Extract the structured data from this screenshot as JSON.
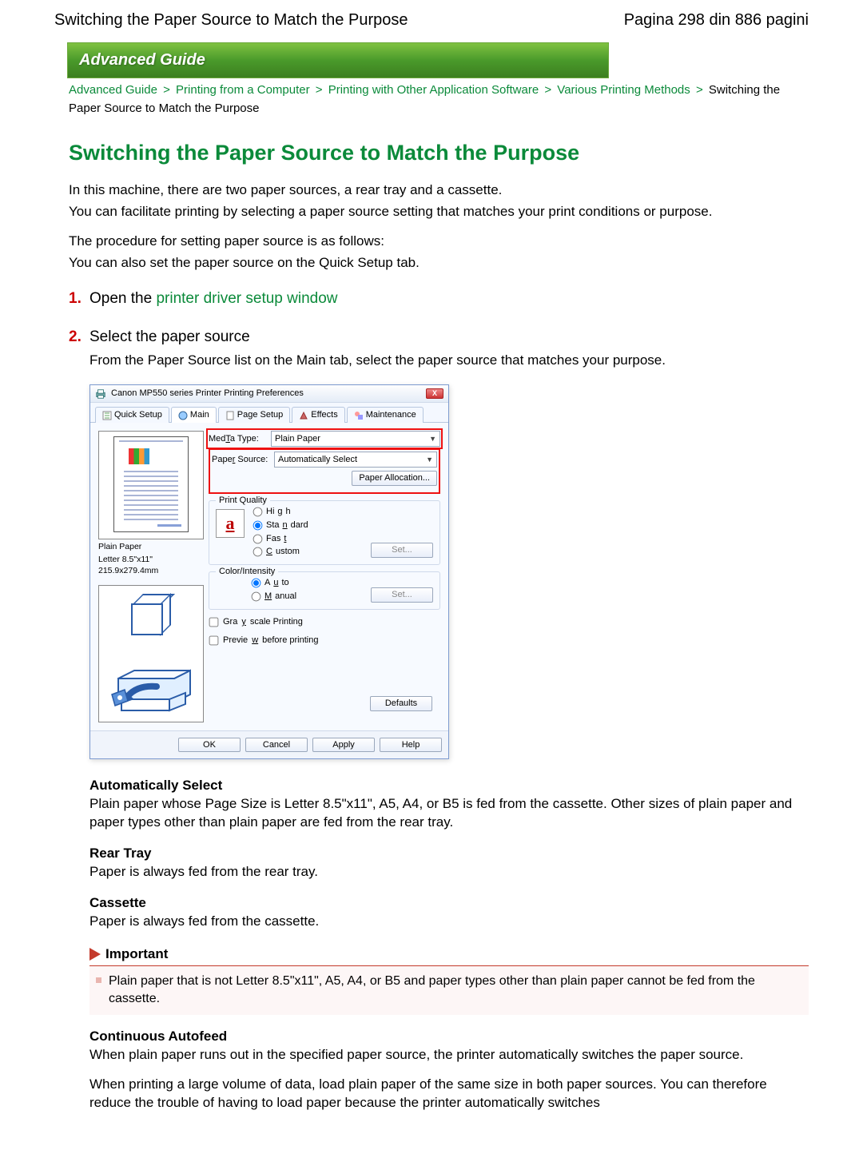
{
  "header": {
    "left": "Switching the Paper Source to Match the Purpose",
    "right": "Pagina 298 din 886 pagini"
  },
  "banner": "Advanced Guide",
  "crumbs": {
    "c1": "Advanced Guide",
    "c2": "Printing from a Computer",
    "c3": "Printing with Other Application Software",
    "c4": "Various Printing Methods",
    "current": "Switching the Paper Source to Match the Purpose",
    "sep": ">"
  },
  "title": "Switching the Paper Source to Match the Purpose",
  "intro": {
    "p1": "In this machine, there are two paper sources, a rear tray and a cassette.",
    "p2": "You can facilitate printing by selecting a paper source setting that matches your print conditions or purpose.",
    "p3": "The procedure for setting paper source is as follows:",
    "p4": "You can also set the paper source on the Quick Setup tab."
  },
  "steps": {
    "s1": {
      "num": "1.",
      "pre": "Open the ",
      "link": "printer driver setup window"
    },
    "s2": {
      "num": "2.",
      "title": "Select the paper source",
      "desc": "From the Paper Source list on the Main tab, select the paper source that matches your purpose."
    }
  },
  "dialog": {
    "title": "Canon MP550 series Printer Printing Preferences",
    "close": "X",
    "tabs": {
      "quick": "Quick Setup",
      "main": "Main",
      "page": "Page Setup",
      "effects": "Effects",
      "maint": "Maintenance"
    },
    "labels": {
      "media": "Media Type:",
      "media_u": "T",
      "source": "Paper Source:",
      "source_u": "r",
      "alloc": "Paper Allocation...",
      "alloc_u": "o",
      "quality": "Print Quality",
      "high": "High",
      "high_u": "g",
      "standard": "Standard",
      "standard_u": "n",
      "fast": "Fast",
      "fast_u": "t",
      "custom": "Custom",
      "custom_u": "C",
      "set1": "Set...",
      "set1_u": "t",
      "color": "Color/Intensity",
      "auto": "Auto",
      "auto_u": "u",
      "manual": "Manual",
      "manual_u": "M",
      "set2": "Set...",
      "gray": "Grayscale Printing",
      "gray_u": "y",
      "prev": "Preview before printing",
      "prev_u": "w",
      "defaults": "Defaults",
      "defaults_u": "f",
      "ok": "OK",
      "cancel": "Cancel",
      "apply": "Apply",
      "apply_u": "A",
      "help": "Help"
    },
    "values": {
      "media": "Plain Paper",
      "source": "Automatically Select"
    },
    "preview": {
      "l1": "Plain Paper",
      "l2": "Letter 8.5\"x11\" 215.9x279.4mm"
    }
  },
  "options": {
    "auto": {
      "t": "Automatically Select",
      "d": "Plain paper whose Page Size is Letter 8.5\"x11\", A5, A4, or B5 is fed from the cassette. Other sizes of plain paper and paper types other than plain paper are fed from the rear tray."
    },
    "rear": {
      "t": "Rear Tray",
      "d": "Paper is always fed from the rear tray."
    },
    "cass": {
      "t": "Cassette",
      "d": "Paper is always fed from the cassette."
    },
    "cont": {
      "t": "Continuous Autofeed",
      "d1": "When plain paper runs out in the specified paper source, the printer automatically switches the paper source.",
      "d2": "When printing a large volume of data, load plain paper of the same size in both paper sources. You can therefore reduce the trouble of having to load paper because the printer automatically switches"
    }
  },
  "important": {
    "label": "Important",
    "body": "Plain paper that is not Letter 8.5\"x11\", A5, A4, or B5 and paper types other than plain paper cannot be fed from the cassette."
  }
}
